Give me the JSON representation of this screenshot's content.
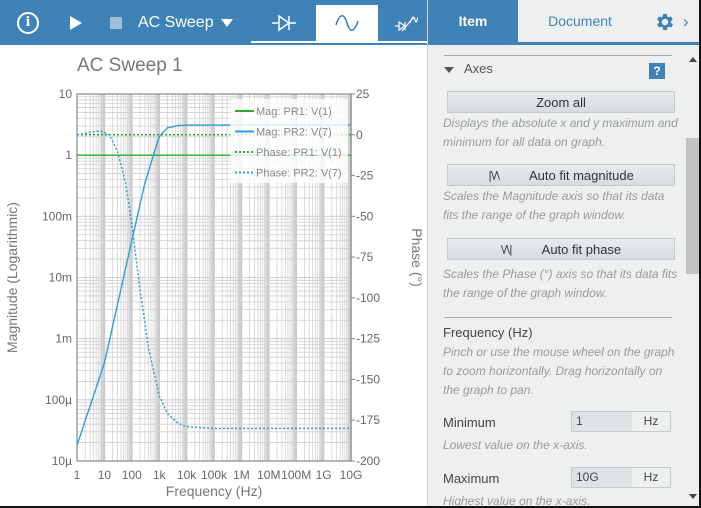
{
  "toolbar": {
    "info_icon": "info-circle-icon",
    "play_icon": "play-icon",
    "stop_icon": "stop-icon",
    "analysis_name": "AC Sweep",
    "dropdown_icon": "triangle-down-icon",
    "mode_tabs": [
      {
        "name": "dc-diode-icon",
        "active": false
      },
      {
        "name": "ac-sine-icon",
        "active": true
      },
      {
        "name": "transient-icon",
        "active": false
      }
    ]
  },
  "panel": {
    "tabs": [
      {
        "label": "Item",
        "active": true
      },
      {
        "label": "Document",
        "active": false
      }
    ],
    "gear_icon": "gear-icon",
    "chevron_icon": "chevron-right-icon",
    "section_title": "Axes",
    "help_label": "?",
    "zoom_all": {
      "label": "Zoom all",
      "desc": "Displays the absolute x and y maximum and minimum for all data on graph."
    },
    "auto_fit_mag": {
      "icon": "|\\/\\",
      "label": "Auto fit magnitude",
      "desc": "Scales the Magnitude axis so that its data fits the range of the graph window."
    },
    "auto_fit_phase": {
      "icon": "\\/\\|",
      "label": "Auto fit phase",
      "desc": "Scales the Phase (°) axis so that its data fits the range of the graph window."
    },
    "frequency": {
      "title": "Frequency (Hz)",
      "desc": "Pinch or use the mouse wheel on the graph to zoom horizontally. Drag horizontally on the graph to pan."
    },
    "minimum": {
      "label": "Minimum",
      "value": "1",
      "unit": "Hz",
      "desc": "Lowest value on the x-axis."
    },
    "maximum": {
      "label": "Maximum",
      "value": "10G",
      "unit": "Hz",
      "desc": "Highest value on the x-axis."
    }
  },
  "chart_data": {
    "type": "line",
    "title": "AC Sweep 1",
    "xlabel": "Frequency (Hz)",
    "ylabel": "Magnitude (Logarithmic)",
    "y2label": "Phase (°)",
    "xscale": "log",
    "xlim": [
      1,
      10000000000
    ],
    "ylim": [
      1e-05,
      10
    ],
    "y2lim": [
      -200,
      25
    ],
    "grid": true,
    "legend_position": "top-right",
    "x_ticks": [
      1,
      10,
      100,
      1000,
      10000,
      100000,
      1000000,
      10000000,
      100000000,
      1000000000,
      10000000000
    ],
    "x_tick_labels": [
      "1",
      "10",
      "100",
      "1k",
      "10k",
      "100k",
      "1M",
      "10M",
      "100M",
      "1G",
      "10G"
    ],
    "y_ticks": [
      10,
      1,
      0.1,
      0.01,
      0.001,
      0.0001,
      1e-05
    ],
    "y_tick_labels": [
      "10",
      "1",
      "100m",
      "10m",
      "1m",
      "100µ",
      "10µ"
    ],
    "y2_ticks": [
      25,
      0,
      -25,
      -50,
      -75,
      -100,
      -125,
      -150,
      -175,
      -200
    ],
    "y2_tick_labels": [
      "25",
      "0",
      "-25",
      "-50",
      "-75",
      "-100",
      "-125",
      "-150",
      "-175",
      "-200"
    ],
    "series": [
      {
        "name": "Mag: PR1: V(1)",
        "axis": "left",
        "style": "solid",
        "color": "#22b02c",
        "x": [
          1,
          10000000000
        ],
        "y": [
          1,
          1
        ]
      },
      {
        "name": "Mag: PR2: V(7)",
        "axis": "left",
        "style": "solid",
        "color": "#2a9fd8",
        "x": [
          1,
          10,
          100,
          300,
          1000,
          2000,
          5000,
          10000,
          100000,
          10000000000
        ],
        "y": [
          1.8e-05,
          0.0004,
          0.04,
          0.35,
          2.0,
          2.8,
          3.05,
          3.1,
          3.1,
          3.1
        ]
      },
      {
        "name": "Phase: PR1: V(1)",
        "axis": "right",
        "style": "dotted",
        "color": "#22b02c",
        "x": [
          1,
          10000000000
        ],
        "y": [
          0,
          0
        ]
      },
      {
        "name": "Phase: PR2: V(7)",
        "axis": "right",
        "style": "dotted",
        "color": "#2a9fd8",
        "x": [
          1,
          3,
          7,
          15,
          30,
          60,
          100,
          200,
          400,
          1000,
          2000,
          5000,
          10000,
          100000,
          10000000000
        ],
        "y": [
          0,
          1.5,
          2.5,
          0,
          -10,
          -30,
          -55,
          -95,
          -130,
          -160,
          -171,
          -177,
          -179,
          -180,
          -180
        ]
      }
    ]
  }
}
